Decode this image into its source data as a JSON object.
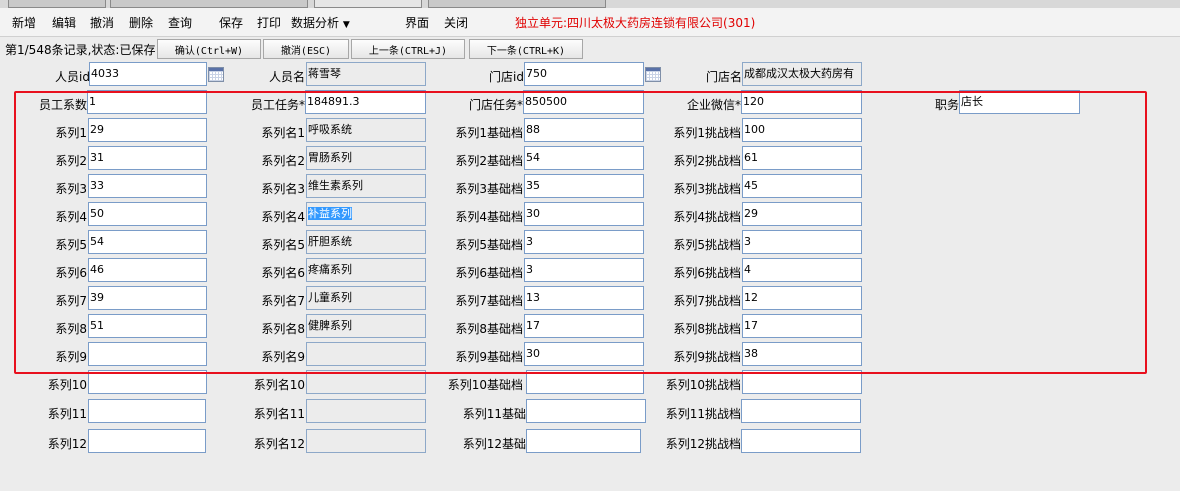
{
  "menubar": {
    "items": [
      "新增",
      "编辑",
      "撤消",
      "删除",
      "查询",
      "保存",
      "打印",
      "数据分析",
      "界面",
      "关闭"
    ],
    "company": "独立单元:四川太极大药房连锁有限公司(301)"
  },
  "toolbar": {
    "status": "第1/548条记录,状态:已保存",
    "buttons": [
      "确认(Ctrl+W)",
      "撤消(ESC)",
      "上一条(CTRL+J)",
      "下一条(CTRL+K)"
    ]
  },
  "form": {
    "staff_id_label": "人员id",
    "staff_id": "4033",
    "staff_name_label": "人员名",
    "staff_name": "蒋雪琴",
    "store_id_label": "门店id",
    "store_id": "750",
    "store_name_label": "门店名",
    "store_name": "成都成汉太极大药房有",
    "emp_coef_label": "员工系数",
    "emp_coef": "1",
    "emp_task_label": "员工任务*",
    "emp_task": "184891.3",
    "store_task_label": "门店任务*",
    "store_task": "850500",
    "wechat_label": "企业微信*",
    "wechat": "120",
    "position_label": "职务",
    "position": "店长"
  },
  "series": [
    {
      "label": "系列1",
      "value": "29",
      "name_label": "系列名1",
      "name": "呼吸系统",
      "base_label": "系列1基础档",
      "base": "88",
      "chal_label": "系列1挑战档",
      "chal": "100"
    },
    {
      "label": "系列2",
      "value": "31",
      "name_label": "系列名2",
      "name": "胃肠系列",
      "base_label": "系列2基础档",
      "base": "54",
      "chal_label": "系列2挑战档",
      "chal": "61"
    },
    {
      "label": "系列3",
      "value": "33",
      "name_label": "系列名3",
      "name": "维生素系列",
      "base_label": "系列3基础档",
      "base": "35",
      "chal_label": "系列3挑战档",
      "chal": "45"
    },
    {
      "label": "系列4",
      "value": "50",
      "name_label": "系列名4",
      "name": "补益系列",
      "base_label": "系列4基础档",
      "base": "30",
      "chal_label": "系列4挑战档",
      "chal": "29"
    },
    {
      "label": "系列5",
      "value": "54",
      "name_label": "系列名5",
      "name": "肝胆系统",
      "base_label": "系列5基础档",
      "base": "3",
      "chal_label": "系列5挑战档",
      "chal": "3"
    },
    {
      "label": "系列6",
      "value": "46",
      "name_label": "系列名6",
      "name": "疼痛系列",
      "base_label": "系列6基础档",
      "base": "3",
      "chal_label": "系列6挑战档",
      "chal": "4"
    },
    {
      "label": "系列7",
      "value": "39",
      "name_label": "系列名7",
      "name": "儿童系列",
      "base_label": "系列7基础档",
      "base": "13",
      "chal_label": "系列7挑战档",
      "chal": "12"
    },
    {
      "label": "系列8",
      "value": "51",
      "name_label": "系列名8",
      "name": "健脾系列",
      "base_label": "系列8基础档",
      "base": "17",
      "chal_label": "系列8挑战档",
      "chal": "17"
    },
    {
      "label": "系列9",
      "value": "",
      "name_label": "系列名9",
      "name": "",
      "base_label": "系列9基础档",
      "base": "30",
      "chal_label": "系列9挑战档",
      "chal": "38"
    },
    {
      "label": "系列10",
      "value": "",
      "name_label": "系列名10",
      "name": "",
      "base_label": "系列10基础档",
      "base": "",
      "chal_label": "系列10挑战档",
      "chal": ""
    },
    {
      "label": "系列11",
      "value": "",
      "name_label": "系列名11",
      "name": "",
      "base_label": "系列11基础",
      "base": "",
      "chal_label": "系列11挑战档",
      "chal": ""
    },
    {
      "label": "系列12",
      "value": "",
      "name_label": "系列名12",
      "name": "",
      "base_label": "系列12基础",
      "base": "",
      "chal_label": "系列12挑战档",
      "chal": ""
    }
  ],
  "colors": {
    "highlight_box": "#e8101e",
    "company_text": "#e00000",
    "selection": "#3399ff"
  }
}
